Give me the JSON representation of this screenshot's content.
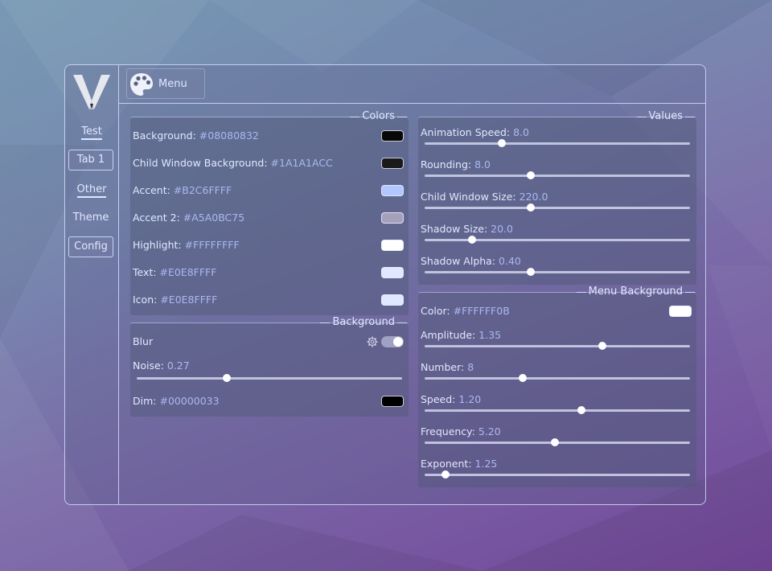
{
  "sidebar": {
    "items": [
      {
        "label": "Test",
        "kind": "header"
      },
      {
        "label": "Tab 1",
        "kind": "button"
      },
      {
        "label": "Other",
        "kind": "header"
      },
      {
        "label": "Theme",
        "kind": "plain"
      },
      {
        "label": "Config",
        "kind": "button"
      }
    ]
  },
  "topbar": {
    "menu_label": "Menu",
    "menu_icon": "palette-icon"
  },
  "colors_panel": {
    "title": "Colors",
    "rows": [
      {
        "label": "Background:",
        "value": "#08080832",
        "swatch": "#080808"
      },
      {
        "label": "Child Window Background:",
        "value": "#1A1A1ACC",
        "swatch": "#1a1a1a"
      },
      {
        "label": "Accent:",
        "value": "#B2C6FFFF",
        "swatch": "#b2c6ff"
      },
      {
        "label": "Accent 2:",
        "value": "#A5A0BC75",
        "swatch": "#a5a0bc"
      },
      {
        "label": "Highlight:",
        "value": "#FFFFFFFF",
        "swatch": "#ffffff"
      },
      {
        "label": "Text:",
        "value": "#E0E8FFFF",
        "swatch": "#e0e8ff"
      },
      {
        "label": "Icon:",
        "value": "#E0E8FFFF",
        "swatch": "#e0e8ff"
      }
    ]
  },
  "background_panel": {
    "title": "Background",
    "blur_label": "Blur",
    "blur_enabled": true,
    "noise_label": "Noise:",
    "noise_value": "0.27",
    "noise_fraction": 0.34,
    "dim_label": "Dim:",
    "dim_value": "#00000033",
    "dim_swatch": "#000000"
  },
  "values_panel": {
    "title": "Values",
    "sliders": [
      {
        "label": "Animation Speed:",
        "value": "8.0",
        "fraction": 0.29
      },
      {
        "label": "Rounding:",
        "value": "8.0",
        "fraction": 0.4
      },
      {
        "label": "Child Window Size:",
        "value": "220.0",
        "fraction": 0.4
      },
      {
        "label": "Shadow Size:",
        "value": "20.0",
        "fraction": 0.18
      },
      {
        "label": "Shadow Alpha:",
        "value": "0.40",
        "fraction": 0.4
      }
    ]
  },
  "menu_bg_panel": {
    "title": "Menu Background",
    "color_label": "Color:",
    "color_value": "#FFFFFF0B",
    "color_swatch": "#ffffff",
    "sliders": [
      {
        "label": "Amplitude:",
        "value": "1.35",
        "fraction": 0.67
      },
      {
        "label": "Number:",
        "value": "8",
        "fraction": 0.37
      },
      {
        "label": "Speed:",
        "value": "1.20",
        "fraction": 0.59
      },
      {
        "label": "Frequency:",
        "value": "5.20",
        "fraction": 0.49
      },
      {
        "label": "Exponent:",
        "value": "1.25",
        "fraction": 0.08
      }
    ]
  }
}
